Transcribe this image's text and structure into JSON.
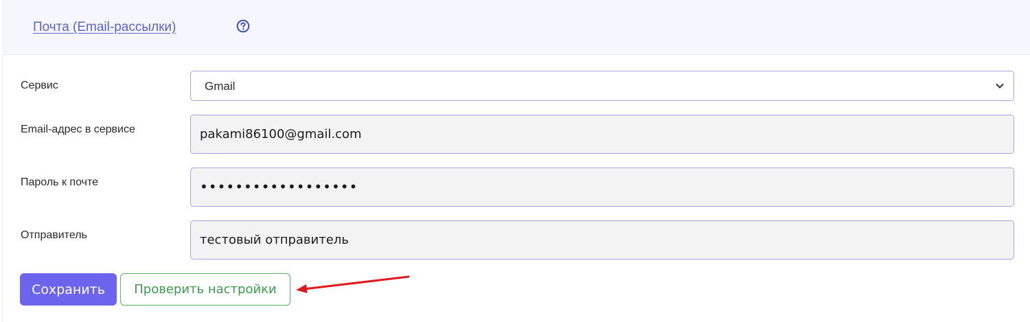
{
  "header": {
    "title": "Почта (Email-рассылки)",
    "help_icon": "question-circle-icon"
  },
  "form": {
    "service": {
      "label": "Сервис",
      "selected": "Gmail"
    },
    "email": {
      "label": "Email-адрес в сервисе",
      "value": "pakami86100@gmail.com"
    },
    "password": {
      "label": "Пароль к почте",
      "masked_value": "••••••••••••••••••"
    },
    "sender": {
      "label": "Отправитель",
      "value": "тестовый отправитель"
    }
  },
  "actions": {
    "save_label": "Сохранить",
    "check_label": "Проверить настройки"
  },
  "colors": {
    "header_bg": "#f5f6fe",
    "link": "#5c63c8",
    "save_button": "#6d64ee",
    "check_button": "#3e9a4e",
    "annotation_arrow": "#e0191c"
  }
}
